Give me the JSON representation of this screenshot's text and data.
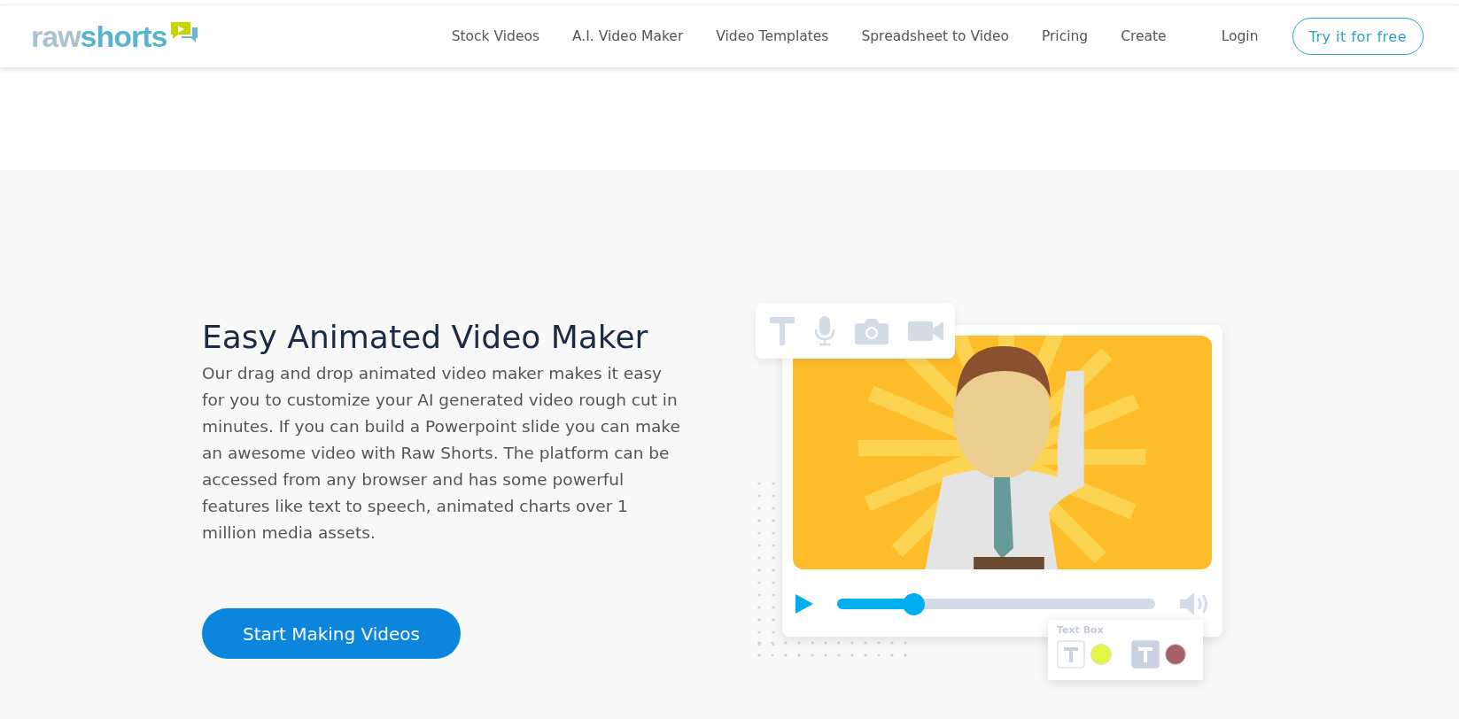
{
  "header": {
    "logo": {
      "first": "raw",
      "second": "shorts"
    },
    "nav": [
      "Stock Videos",
      "A.I. Video Maker",
      "Video Templates",
      "Spreadsheet to Video",
      "Pricing",
      "Create"
    ],
    "login": "Login",
    "cta": "Try it for free"
  },
  "hero": {
    "title": "Easy Animated Video Maker",
    "body": "Our drag and drop animated video maker makes it easy for you to customize your AI generated video rough cut in minutes. If you can build a Powerpoint slide you can make an awesome video with Raw Shorts. The platform can be accessed from any browser and has some powerful features like text to speech, animated charts over 1 million media assets.",
    "button": "Start Making Videos"
  },
  "player": {
    "level": 0.24
  },
  "text_box": {
    "label": "Text Box",
    "styles": [
      {
        "selected": false,
        "color": "#e2f544"
      },
      {
        "selected": true,
        "color": "#a66068"
      }
    ]
  }
}
